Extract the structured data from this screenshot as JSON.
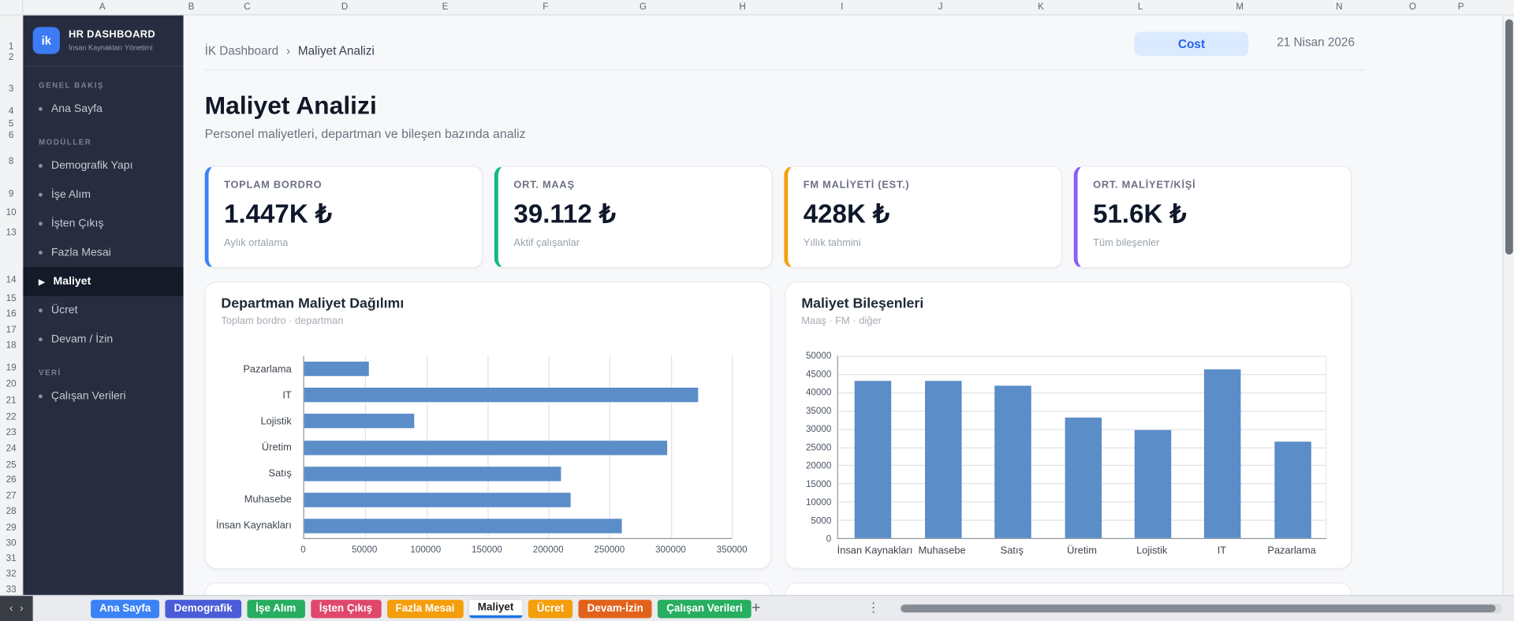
{
  "spreadsheet": {
    "column_letters": [
      "A",
      "B",
      "C",
      "D",
      "E",
      "F",
      "G",
      "H",
      "I",
      "J",
      "K",
      "L",
      "M",
      "N",
      "O",
      "P"
    ],
    "row_numbers": [
      "1",
      "2",
      "3",
      "4",
      "5",
      "6",
      "8",
      "9",
      "10",
      "13",
      "14",
      "15",
      "16",
      "17",
      "18",
      "19",
      "20",
      "21",
      "22",
      "23",
      "24",
      "25",
      "26",
      "27",
      "28",
      "29",
      "30",
      "31",
      "32",
      "33"
    ]
  },
  "sidebar": {
    "logo_text": "ik",
    "title": "HR DASHBOARD",
    "subtitle": "İnsan Kaynakları Yönetimi",
    "active_icon": "▶",
    "sections": [
      {
        "label": "GENEL BAKIŞ",
        "items": [
          {
            "label": "Ana Sayfa"
          }
        ]
      },
      {
        "label": "MODÜLLER",
        "items": [
          {
            "label": "Demografik Yapı"
          },
          {
            "label": "İşe Alım"
          },
          {
            "label": "İşten Çıkış"
          },
          {
            "label": "Fazla Mesai"
          },
          {
            "label": "Maliyet",
            "active": true
          },
          {
            "label": "Ücret"
          },
          {
            "label": "Devam / İzin"
          }
        ]
      },
      {
        "label": "VERİ",
        "items": [
          {
            "label": "Çalışan Verileri"
          }
        ]
      }
    ]
  },
  "header": {
    "breadcrumb_root": "İK Dashboard",
    "separator": "›",
    "breadcrumb_current": "Maliyet Analizi",
    "cost_button": "Cost",
    "date": "21 Nisan 2026"
  },
  "page": {
    "title": "Maliyet Analizi",
    "subtitle": "Personel maliyetleri, departman ve bileşen bazında analiz"
  },
  "kpis": [
    {
      "label": "TOPLAM BORDRO",
      "value": "1.447K ₺",
      "sub": "Aylık ortalama",
      "accent": "#3b82f6"
    },
    {
      "label": "ORT. MAAŞ",
      "value": "39.112 ₺",
      "sub": "Aktif çalışanlar",
      "accent": "#10b981"
    },
    {
      "label": "FM MALİYETİ (EST.)",
      "value": "428K ₺",
      "sub": "Yıllık tahmini",
      "accent": "#f59e0b"
    },
    {
      "label": "ORT. MALİYET/KİŞİ",
      "value": "51.6K ₺",
      "sub": "Tüm bileşenler",
      "accent": "#8b5cf6"
    }
  ],
  "chart_data": [
    {
      "type": "bar",
      "orientation": "horizontal",
      "title": "Departman Maliyet Dağılımı",
      "subtitle": "Toplam bordro · departman",
      "categories": [
        "Pazarlama",
        "IT",
        "Lojistik",
        "Üretim",
        "Satış",
        "Muhasebe",
        "İnsan Kaynakları"
      ],
      "values": [
        53000,
        322000,
        90000,
        297000,
        210000,
        218000,
        260000
      ],
      "xlabel": "",
      "ylabel": "",
      "xlim": [
        0,
        350000
      ],
      "xticks": [
        0,
        50000,
        100000,
        150000,
        200000,
        250000,
        300000,
        350000
      ],
      "grid": true,
      "legend": false,
      "bar_color": "#5b8dc8"
    },
    {
      "type": "bar",
      "orientation": "vertical",
      "title": "Maliyet Bileşenleri",
      "subtitle": "Maaş · FM · diğer",
      "categories": [
        "İnsan Kaynakları",
        "Muhasebe",
        "Satış",
        "Üretim",
        "Lojistik",
        "IT",
        "Pazarlama"
      ],
      "values": [
        43000,
        43000,
        41500,
        33000,
        29500,
        46000,
        26300
      ],
      "xlabel": "",
      "ylabel": "",
      "ylim": [
        0,
        50000
      ],
      "yticks": [
        0,
        5000,
        10000,
        15000,
        20000,
        25000,
        30000,
        35000,
        40000,
        45000,
        50000
      ],
      "grid": true,
      "legend": false,
      "bar_color": "#5b8dc8"
    }
  ],
  "bottom_tabs": {
    "nav_prev": "‹",
    "nav_next": "›",
    "add_label": "+",
    "menu_icon": "⋮",
    "active_color": "#1a73e8",
    "tabs": [
      {
        "label": "Ana Sayfa",
        "color": "#3b82f6"
      },
      {
        "label": "Demografik",
        "color": "#4a5cd8"
      },
      {
        "label": "İşe Alım",
        "color": "#27ae60"
      },
      {
        "label": "İşten Çıkış",
        "color": "#e0476c"
      },
      {
        "label": "Fazla Mesai",
        "color": "#f59e0b"
      },
      {
        "label": "Maliyet",
        "active": true
      },
      {
        "label": "Ücret",
        "color": "#f59e0b"
      },
      {
        "label": "Devam-İzin",
        "color": "#e2621b"
      },
      {
        "label": "Çalışan Verileri",
        "color": "#27ae60"
      }
    ]
  }
}
